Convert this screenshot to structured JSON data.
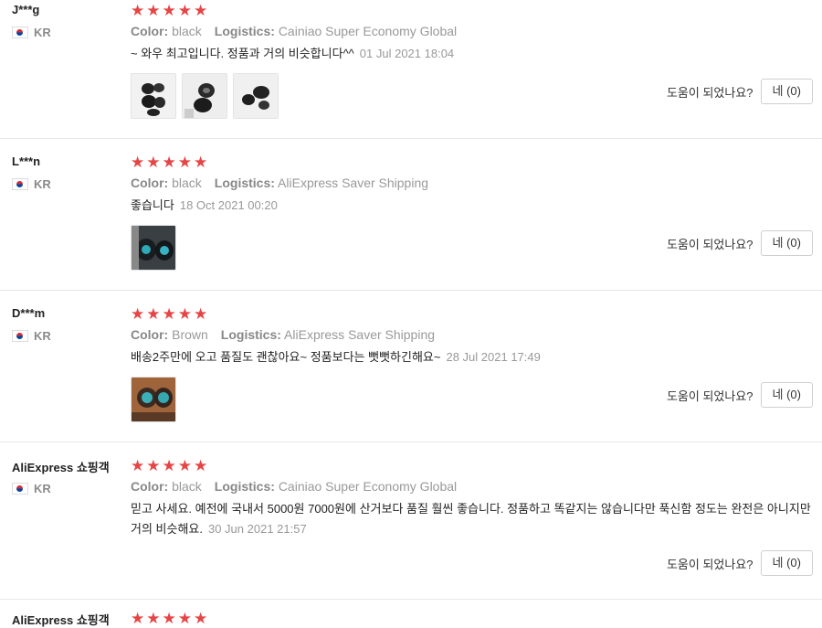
{
  "reviews": [
    {
      "user": "J***g",
      "country": "KR",
      "stars": "★★★★★",
      "color_label": "Color:",
      "color": "black",
      "logistics_label": "Logistics:",
      "logistics": "Cainiao Super Economy Global",
      "text": "~ 와우 최고입니다. 정품과 거의 비슷합니다^^",
      "date": "01 Jul 2021 18:04",
      "helpful_q": "도움이 되었나요?",
      "helpful_btn": "네 (0)"
    },
    {
      "user": "L***n",
      "country": "KR",
      "stars": "★★★★★",
      "color_label": "Color:",
      "color": "black",
      "logistics_label": "Logistics:",
      "logistics": "AliExpress Saver Shipping",
      "text": "좋습니다",
      "date": "18 Oct 2021 00:20",
      "helpful_q": "도움이 되었나요?",
      "helpful_btn": "네 (0)"
    },
    {
      "user": "D***m",
      "country": "KR",
      "stars": "★★★★★",
      "color_label": "Color:",
      "color": "Brown",
      "logistics_label": "Logistics:",
      "logistics": "AliExpress Saver Shipping",
      "text": "배송2주만에 오고 품질도 괜찮아요~ 정품보다는 뻣뻣하긴해요~",
      "date": "28 Jul 2021 17:49",
      "helpful_q": "도움이 되었나요?",
      "helpful_btn": "네 (0)"
    },
    {
      "user": "AliExpress 쇼핑객",
      "country": "KR",
      "stars": "★★★★★",
      "color_label": "Color:",
      "color": "black",
      "logistics_label": "Logistics:",
      "logistics": "Cainiao Super Economy Global",
      "text": "믿고 사세요. 예전에 국내서 5000원 7000원에 산거보다 품질 훨씬 좋습니다. 정품하고 똑같지는 않습니다만 푹신함 정도는 완전은 아니지만 거의 비슷해요.",
      "date": "30 Jun 2021 21:57",
      "helpful_q": "도움이 되었나요?",
      "helpful_btn": "네 (0)"
    },
    {
      "user": "AliExpress 쇼핑객",
      "stars": "★★★★★"
    }
  ],
  "colors": {
    "star": "#e64545",
    "muted": "#999999",
    "divider": "#e8e8e8"
  }
}
